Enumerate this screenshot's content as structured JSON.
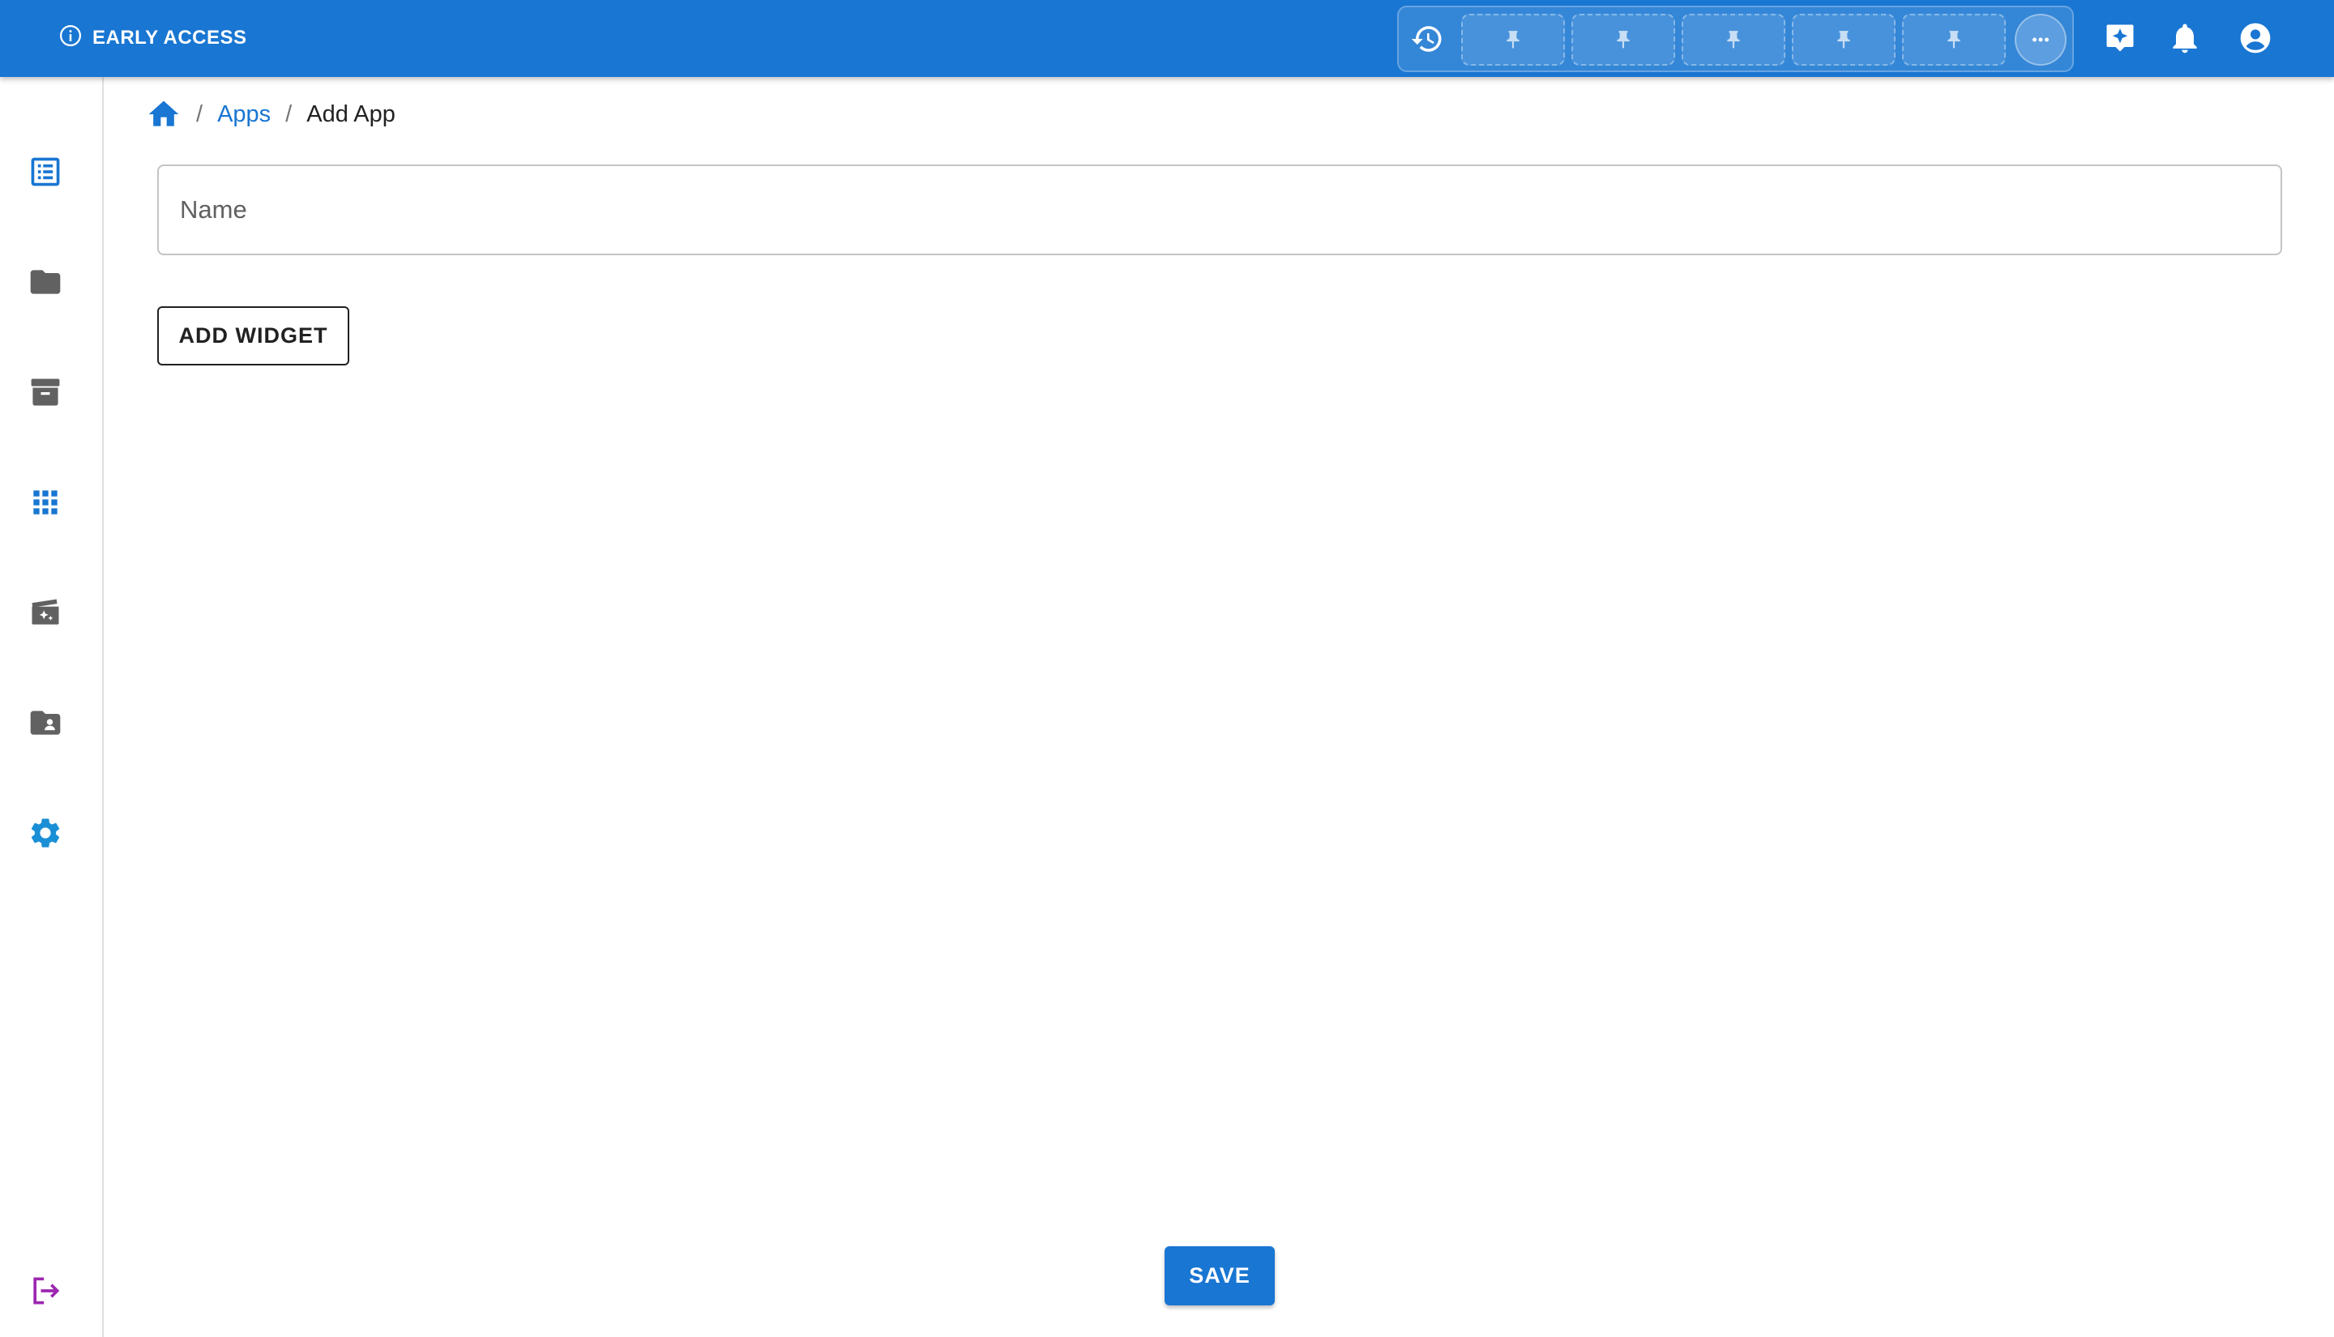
{
  "topbar": {
    "badge_label": "EARLY ACCESS",
    "background_color": "#1976d2",
    "icons": {
      "info": "info-icon",
      "history": "history-icon",
      "pin": "pin-icon",
      "more": "more-horizontal-icon",
      "ai_assistant": "sparkle-chat-icon",
      "notifications": "bell-icon",
      "account": "account-circle-icon"
    },
    "pin_slots": 5
  },
  "sidebar": {
    "items": [
      {
        "name": "list",
        "icon": "list-icon",
        "color": "#1976d2"
      },
      {
        "name": "folder",
        "icon": "folder-icon",
        "color": "#616161"
      },
      {
        "name": "archive",
        "icon": "archive-icon",
        "color": "#616161"
      },
      {
        "name": "apps",
        "icon": "apps-grid-icon",
        "color": "#1976d2"
      },
      {
        "name": "media",
        "icon": "movie-sparkle-icon",
        "color": "#616161"
      },
      {
        "name": "shared-folder",
        "icon": "folder-account-icon",
        "color": "#616161"
      },
      {
        "name": "settings",
        "icon": "gear-icon",
        "color": "#1a8fd6"
      }
    ],
    "logout": {
      "icon": "logout-icon",
      "color": "#9c27b0"
    }
  },
  "breadcrumb": {
    "home_icon": "home-icon",
    "separator": "/",
    "items": [
      "Apps",
      "Add App"
    ]
  },
  "form": {
    "name_placeholder": "Name",
    "name_value": "",
    "add_widget_label": "ADD WIDGET",
    "save_label": "SAVE"
  },
  "colors": {
    "primary": "#1976d2",
    "logout": "#9c27b0"
  }
}
